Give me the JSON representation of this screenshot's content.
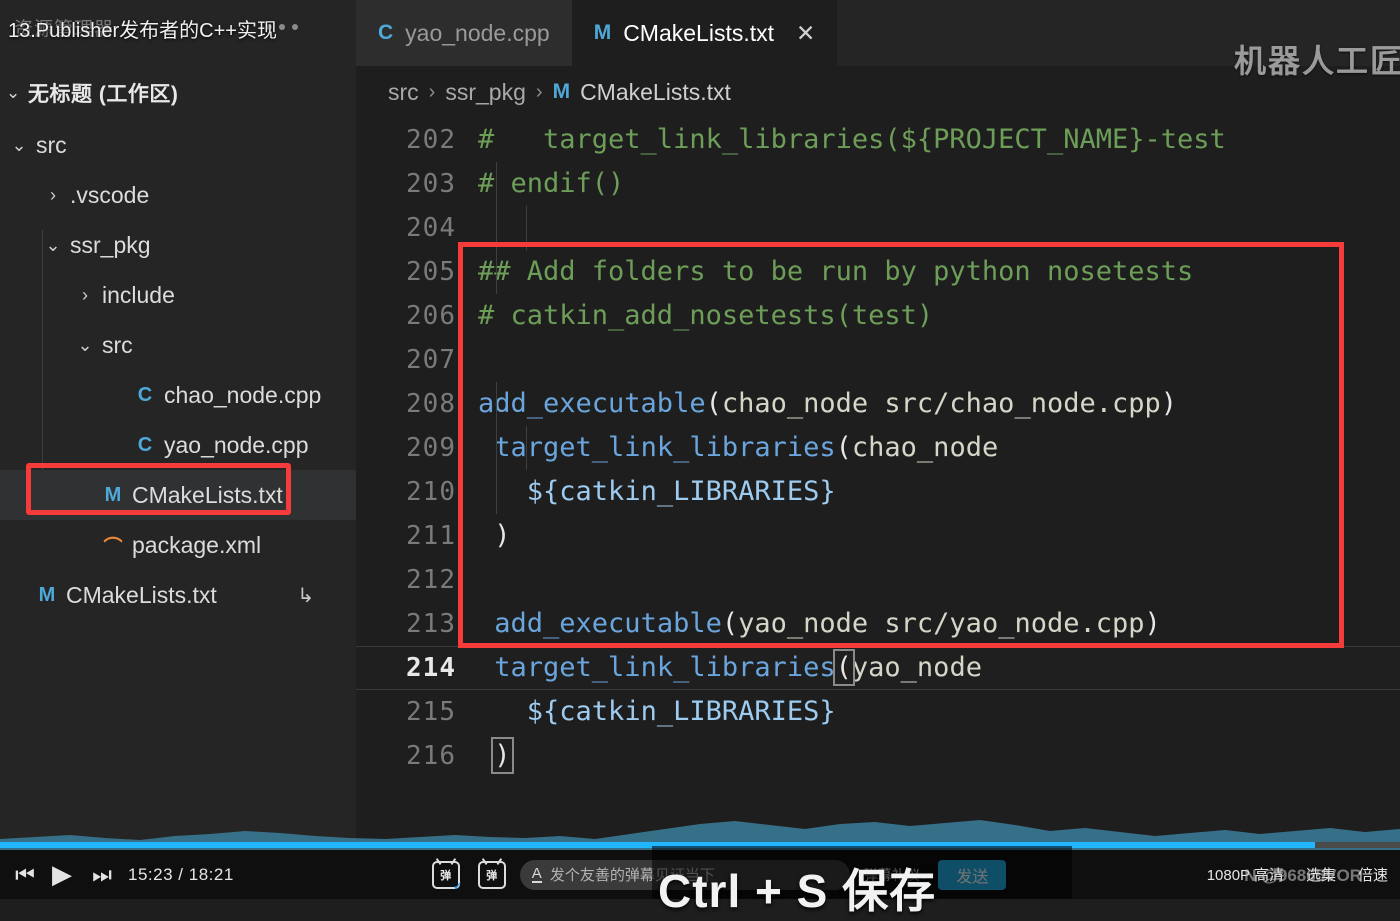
{
  "overlay": {
    "video_title": "13.Publisher发布者的C++实现",
    "watermark": "机器人工匠",
    "subtitle": "Ctrl + S 保存",
    "bottom_watermark": "N @96865VOR"
  },
  "sidebar": {
    "header_title": "资源管理器",
    "more_actions": "...",
    "workspace": {
      "chevron": "⌄",
      "label": "无标题 (工作区)"
    },
    "tree": [
      {
        "twist": "⌄",
        "icon": "",
        "icon_kind": "none",
        "label": "src",
        "indent": 6,
        "selected": false
      },
      {
        "twist": "›",
        "icon": "",
        "icon_kind": "none",
        "label": ".vscode",
        "indent": 40,
        "selected": false
      },
      {
        "twist": "⌄",
        "icon": "",
        "icon_kind": "none",
        "label": "ssr_pkg",
        "indent": 40,
        "selected": false
      },
      {
        "twist": "›",
        "icon": "",
        "icon_kind": "none",
        "label": "include",
        "indent": 72,
        "selected": false
      },
      {
        "twist": "⌄",
        "icon": "",
        "icon_kind": "none",
        "label": "src",
        "indent": 72,
        "selected": false
      },
      {
        "twist": "",
        "icon": "C",
        "icon_kind": "cpp",
        "label": "chao_node.cpp",
        "indent": 104,
        "selected": false
      },
      {
        "twist": "",
        "icon": "C",
        "icon_kind": "cpp",
        "label": "yao_node.cpp",
        "indent": 104,
        "selected": false
      },
      {
        "twist": "",
        "icon": "M",
        "icon_kind": "m",
        "label": "CMakeLists.txt",
        "indent": 72,
        "selected": true
      },
      {
        "twist": "",
        "icon": "⌒",
        "icon_kind": "xml",
        "label": "package.xml",
        "indent": 72,
        "selected": false
      },
      {
        "twist": "",
        "icon": "M",
        "icon_kind": "m",
        "label": "CMakeLists.txt",
        "indent": 6,
        "selected": false,
        "trailing": "↳"
      }
    ]
  },
  "editor": {
    "tabs": [
      {
        "icon": "C",
        "label": "yao_node.cpp",
        "active": false,
        "close": ""
      },
      {
        "icon": "M",
        "label": "CMakeLists.txt",
        "active": true,
        "close": "✕"
      }
    ],
    "breadcrumb": {
      "part1": "src",
      "sep1": "›",
      "part2": "ssr_pkg",
      "sep2": "›",
      "file_icon": "M",
      "file": "CMakeLists.txt"
    },
    "lines": [
      {
        "n": "202",
        "active": false,
        "tokens": [
          {
            "t": "#   target_link_libraries(${PROJECT_NAME}-test",
            "c": "cmt"
          }
        ]
      },
      {
        "n": "203",
        "active": false,
        "tokens": [
          {
            "t": "# endif()",
            "c": "cmt"
          }
        ]
      },
      {
        "n": "204",
        "active": false,
        "tokens": []
      },
      {
        "n": "205",
        "active": false,
        "tokens": [
          {
            "t": "## Add folders to be run by python nosetests",
            "c": "cmt"
          }
        ]
      },
      {
        "n": "206",
        "active": false,
        "tokens": [
          {
            "t": "# catkin_add_nosetests(test)",
            "c": "cmt"
          }
        ]
      },
      {
        "n": "207",
        "active": false,
        "tokens": []
      },
      {
        "n": "208",
        "active": false,
        "tokens": [
          {
            "t": "add_executable",
            "c": "fn"
          },
          {
            "t": "(",
            "c": "pun"
          },
          {
            "t": "chao_node src/chao_node.cpp",
            "c": "arg"
          },
          {
            "t": ")",
            "c": "pun"
          }
        ]
      },
      {
        "n": "209",
        "active": false,
        "tokens": [
          {
            "t": " ",
            "c": "pun"
          },
          {
            "t": "target_link_libraries",
            "c": "fn"
          },
          {
            "t": "(",
            "c": "pun"
          },
          {
            "t": "chao_node",
            "c": "arg"
          }
        ]
      },
      {
        "n": "210",
        "active": false,
        "tokens": [
          {
            "t": "   ",
            "c": "pun"
          },
          {
            "t": "${catkin_LIBRARIES}",
            "c": "var"
          }
        ]
      },
      {
        "n": "211",
        "active": false,
        "tokens": [
          {
            "t": " ",
            "c": "pun"
          },
          {
            "t": ")",
            "c": "pun"
          }
        ]
      },
      {
        "n": "212",
        "active": false,
        "tokens": []
      },
      {
        "n": "213",
        "active": false,
        "tokens": [
          {
            "t": " ",
            "c": "pun"
          },
          {
            "t": "add_executable",
            "c": "fn"
          },
          {
            "t": "(",
            "c": "pun"
          },
          {
            "t": "yao_node src/yao_node.cpp",
            "c": "arg"
          },
          {
            "t": ")",
            "c": "pun"
          }
        ]
      },
      {
        "n": "214",
        "active": true,
        "tokens": [
          {
            "t": " ",
            "c": "pun"
          },
          {
            "t": "target_link_libraries",
            "c": "fn"
          },
          {
            "t": "(",
            "c": "pun",
            "bracket": true
          },
          {
            "t": "yao_node",
            "c": "arg"
          }
        ]
      },
      {
        "n": "215",
        "active": false,
        "tokens": [
          {
            "t": "   ",
            "c": "pun"
          },
          {
            "t": "${catkin_LIBRARIES}",
            "c": "var"
          }
        ]
      },
      {
        "n": "216",
        "active": false,
        "tokens": [
          {
            "t": " ",
            "c": "pun"
          },
          {
            "t": ")",
            "c": "pun",
            "bracket": true
          }
        ]
      }
    ],
    "highlight_color": "#f63b3b"
  },
  "player": {
    "prev_icon": "⏮",
    "play_icon": "▶",
    "next_icon": "⏭",
    "time_current": "15:23",
    "time_sep": "/",
    "time_total": "18:21",
    "danmaku_toggle_label": "弹",
    "danmaku_settings_label": "弹",
    "danmaku_placeholder": "发个友善的弹幕见证当下",
    "danmaku_format_icon": "A",
    "etiquette": "弹幕礼仪 ›",
    "send_label": "发送",
    "quality": "1080P 高清",
    "playlist": "选集",
    "speed": "倍速",
    "progress_percent": 94,
    "accent_color": "#23ade5"
  }
}
